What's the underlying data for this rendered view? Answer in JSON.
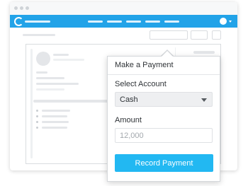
{
  "popover": {
    "title": "Make a Payment",
    "account": {
      "label": "Select Account",
      "selected": "Cash"
    },
    "amount": {
      "label": "Amount",
      "placeholder": "12,000"
    },
    "submit_label": "Record Payment"
  },
  "colors": {
    "app_bar": "#22a3e8",
    "button": "#22b8f2"
  },
  "icons": {
    "logo": "ring-logo-icon",
    "select_caret": "chevron-down-icon"
  }
}
